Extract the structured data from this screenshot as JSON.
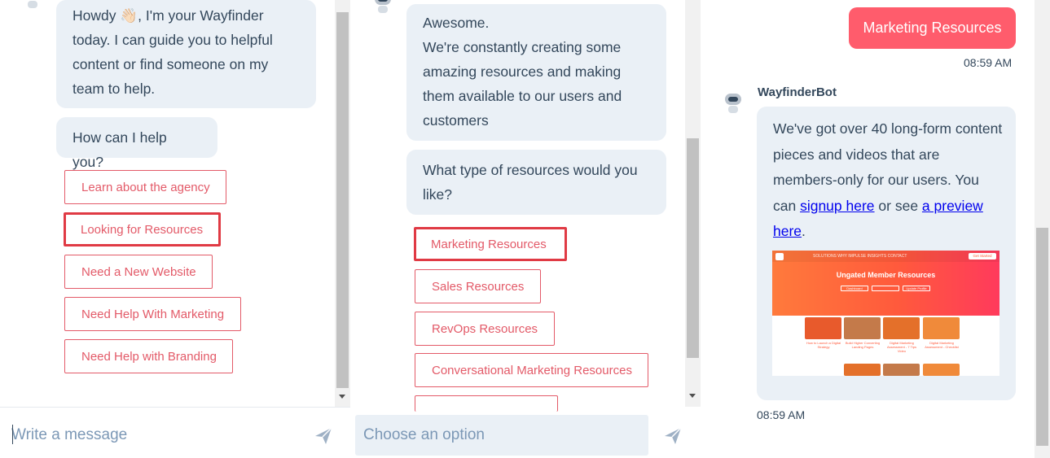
{
  "panel1": {
    "greeting": "Howdy 👋🏻, I'm your Wayfinder today. I can guide you to helpful content or find someone on my team to help.",
    "prompt": "How can I help you?",
    "options": [
      "Learn about the agency",
      "Looking for Resources",
      "Need a New Website",
      "Need Help With Marketing",
      "Need Help with Branding"
    ],
    "input_placeholder": "Write a message",
    "send_icon": "send-icon"
  },
  "panel2": {
    "message_line1": "Awesome.",
    "message_rest": "We're constantly creating some amazing resources and making them available to our users and customers",
    "question": "What type of resources would you like?",
    "options": [
      "Marketing Resources",
      "Sales Resources",
      "RevOps Resources",
      "Conversational Marketing Resources"
    ],
    "choose_placeholder": "Choose an option",
    "send_icon": "send-icon"
  },
  "panel3": {
    "user_message": "Marketing Resources",
    "user_time": "08:59 AM",
    "bot_name": "WayfinderBot",
    "bot_text_pre": "We've got over 40 long-form content pieces and videos that are members-only for our users. You can ",
    "link1": "signup here",
    "bot_text_mid": " or see ",
    "link2": "a preview here",
    "bot_text_post": ".",
    "bot_time": "08:59 AM",
    "preview": {
      "nav_items": "SOLUTIONS   WHY IMPULSE   INSIGHTS   CONTACT",
      "cta": "Get Started",
      "title": "Ungated Member Resources",
      "filters": [
        "Dashboard",
        "",
        "Update Profile"
      ],
      "card_captions": [
        "How to Launch a Digital Strategy",
        "Build Higher Converting Landing Pages",
        "Digital Marketing Assessment - 7 Tips Video",
        "Digital Marketing Assessment - Checklist"
      ],
      "colors": {
        "hero_start": "#ff7a3c",
        "hero_end": "#ff3a5c"
      }
    }
  },
  "colors": {
    "accent": "#e35a68",
    "bubble_bg": "#eaf0f6",
    "user_bubble": "#ff5c6c",
    "text": "#33475b",
    "highlight": "#e03a44"
  }
}
